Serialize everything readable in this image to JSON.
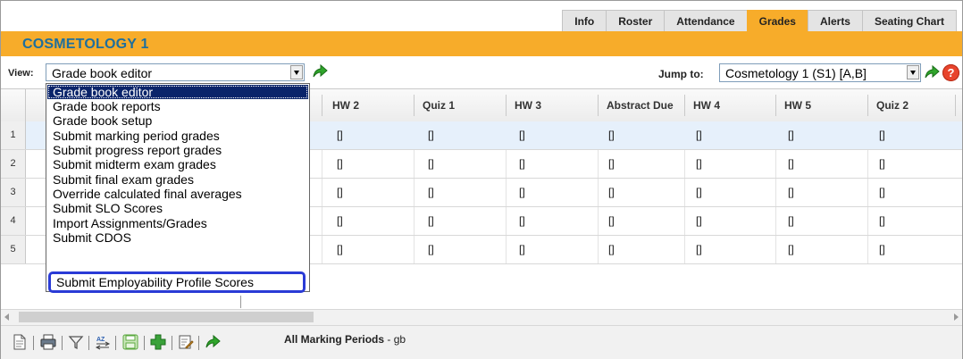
{
  "tabs": [
    {
      "label": "Info",
      "active": false
    },
    {
      "label": "Roster",
      "active": false
    },
    {
      "label": "Attendance",
      "active": false
    },
    {
      "label": "Grades",
      "active": true
    },
    {
      "label": "Alerts",
      "active": false
    },
    {
      "label": "Seating Chart",
      "active": false
    }
  ],
  "course": {
    "title": "COSMETOLOGY 1"
  },
  "view": {
    "label": "View:",
    "selected": "Grade book editor"
  },
  "jump": {
    "label": "Jump to:",
    "selected": "Cosmetology 1 (S1) [A,B]"
  },
  "help": {
    "glyph": "?"
  },
  "dropdown_options": [
    "Grade book editor",
    "Grade book reports",
    "Grade book setup",
    "Submit marking period grades",
    "Submit progress report grades",
    "Submit midterm exam grades",
    "Submit final exam grades",
    "Override calculated final averages",
    "Submit SLO Scores",
    "Import Assignments/Grades",
    "Submit CDOS",
    "Submit Employability Profile Scores"
  ],
  "columns": [
    "HW 2",
    "Quiz 1",
    "HW 3",
    "Abstract Due",
    "HW 4",
    "HW 5",
    "Quiz 2"
  ],
  "rows": [
    {
      "num": "1",
      "cells": [
        "[]",
        "[]",
        "[]",
        "[]",
        "[]",
        "[]",
        "[]"
      ]
    },
    {
      "num": "2",
      "cells": [
        "[]",
        "[]",
        "[]",
        "[]",
        "[]",
        "[]",
        "[]"
      ]
    },
    {
      "num": "3",
      "cells": [
        "[]",
        "[]",
        "[]",
        "[]",
        "[]",
        "[]",
        "[]"
      ]
    },
    {
      "num": "4",
      "cells": [
        "[]",
        "[]",
        "[]",
        "[]",
        "[]",
        "[]",
        "[]"
      ]
    },
    {
      "num": "5",
      "cells": [
        "[]",
        "[]",
        "[]",
        "[]",
        "[]",
        "[]",
        "[]"
      ]
    }
  ],
  "toolbar": {
    "status": "All Marking Periods",
    "status_suffix": " - gb"
  },
  "colors": {
    "accent": "#f7ac2a",
    "title": "#1f6f9d",
    "highlight": "#0a246a",
    "box": "#2a3bd6"
  }
}
